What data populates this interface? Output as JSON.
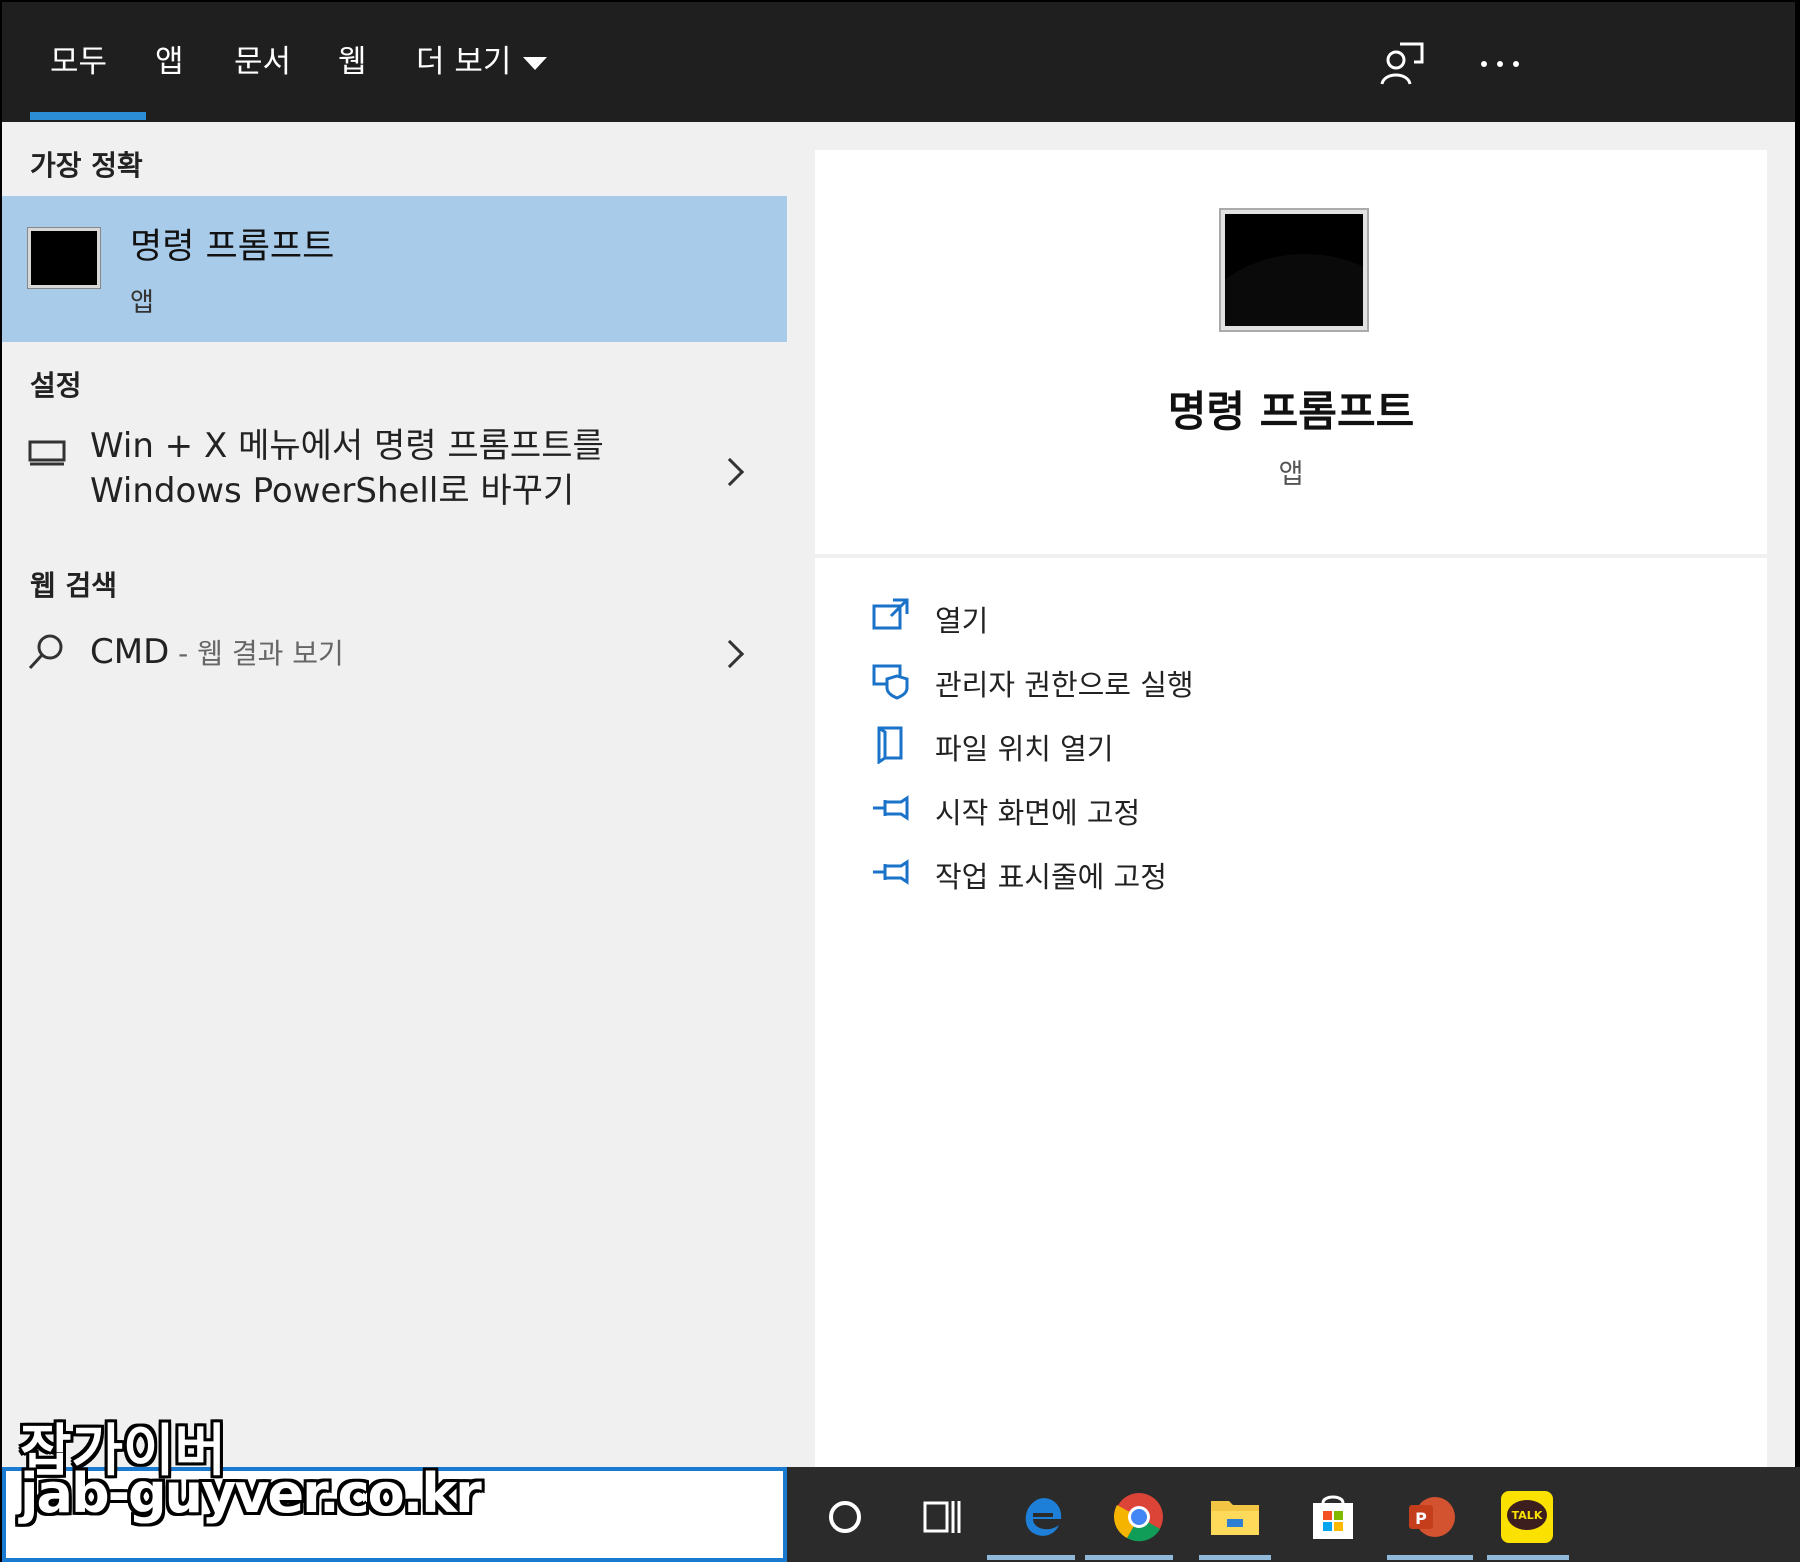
{
  "tabs": [
    {
      "label": "모두"
    },
    {
      "label": "앱"
    },
    {
      "label": "문서"
    },
    {
      "label": "웹"
    },
    {
      "label": "더 보기"
    }
  ],
  "top_icons": [
    "feedback-icon",
    "more-options-icon"
  ],
  "left": {
    "best_match_heading": "가장 정확",
    "best_match": {
      "title": "명령 프롬프트",
      "subtitle": "앱",
      "icon": "command-prompt-icon"
    },
    "settings_heading": "설정",
    "settings_item": {
      "line1": "Win + X 메뉴에서 명령 프롬프트를",
      "line2": "Windows PowerShell로 바꾸기",
      "icon": "monitor-icon"
    },
    "web_heading": "웹 검색",
    "web_item": {
      "query": "CMD",
      "suffix": " - 웹 결과 보기",
      "icon": "search-icon"
    }
  },
  "right": {
    "title": "명령 프롬프트",
    "subtitle": "앱",
    "actions": [
      {
        "label": "열기",
        "icon": "open-icon"
      },
      {
        "label": "관리자 권한으로 실행",
        "icon": "admin-shield-icon"
      },
      {
        "label": "파일 위치 열기",
        "icon": "file-location-icon"
      },
      {
        "label": "시작 화면에 고정",
        "icon": "pin-icon"
      },
      {
        "label": "작업 표시줄에 고정",
        "icon": "pin-icon"
      }
    ]
  },
  "taskbar": {
    "apps": [
      "cortana-icon",
      "task-view-icon",
      "edge-icon",
      "chrome-icon",
      "file-explorer-icon",
      "store-icon",
      "powerpoint-icon",
      "kakaotalk-icon"
    ],
    "kakaotalk_text": "TALK"
  },
  "watermark": {
    "line1": "잡가이버",
    "line2": "jab-guyver.co.kr"
  },
  "colors": {
    "topbar": "#1f1f1f",
    "accent": "#2b8dd6",
    "selected": "#a8cbe9",
    "panel": "#f0f0f0"
  }
}
